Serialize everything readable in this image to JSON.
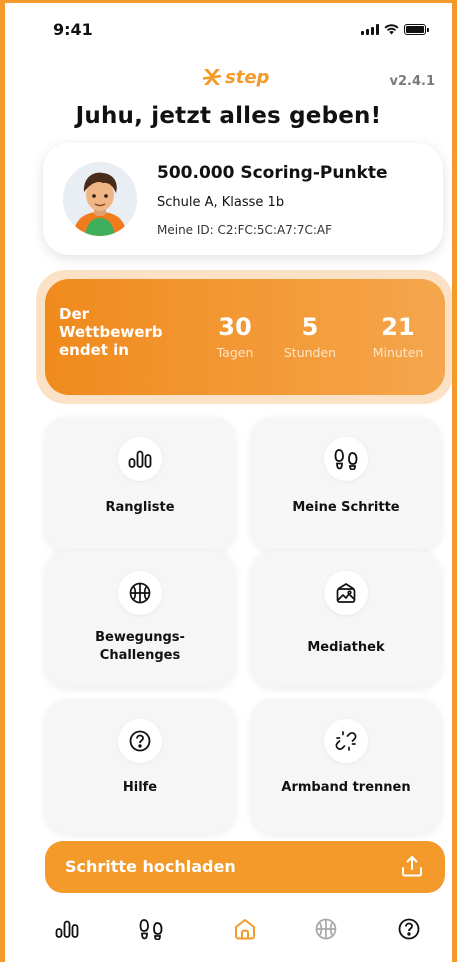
{
  "status_bar": {
    "time": "9:41"
  },
  "header": {
    "logo_text": "step",
    "version": "v2.4.1",
    "headline": "Juhu, jetzt alles geben!"
  },
  "profile": {
    "points": "500.000 Scoring-Punkte",
    "school": "Schule A, Klasse 1b",
    "user_id": "Meine ID: C2:FC:5C:A7:7C:AF"
  },
  "countdown": {
    "label_lines": [
      "Der",
      "Wettbewerb",
      "endet in"
    ],
    "days": {
      "value": "30",
      "unit": "Tagen"
    },
    "hours": {
      "value": "5",
      "unit": "Stunden"
    },
    "minutes": {
      "value": "21",
      "unit": "Minuten"
    }
  },
  "tiles": [
    {
      "label": "Rangliste",
      "icon": "leaderboard-icon"
    },
    {
      "label": "Meine Schritte",
      "icon": "footsteps-icon"
    },
    {
      "label_lines": [
        "Bewegungs-",
        "Challenges"
      ],
      "icon": "basketball-icon"
    },
    {
      "label": "Mediathek",
      "icon": "media-library-icon"
    },
    {
      "label": "Hilfe",
      "icon": "help-icon"
    },
    {
      "label": "Armband trennen",
      "icon": "unlink-icon"
    }
  ],
  "upload": {
    "label": "Schritte hochladen",
    "icon": "upload-icon"
  },
  "bottom_nav": [
    {
      "icon": "leaderboard-icon",
      "active": false
    },
    {
      "icon": "footsteps-icon",
      "active": false
    },
    {
      "icon": "home-icon",
      "active": true
    },
    {
      "icon": "basketball-icon",
      "active": false
    },
    {
      "icon": "help-icon",
      "active": false
    }
  ],
  "colors": {
    "accent": "#f39a2a",
    "inactive_icon": "#111111",
    "disabled_icon": "#a8a8a8"
  }
}
